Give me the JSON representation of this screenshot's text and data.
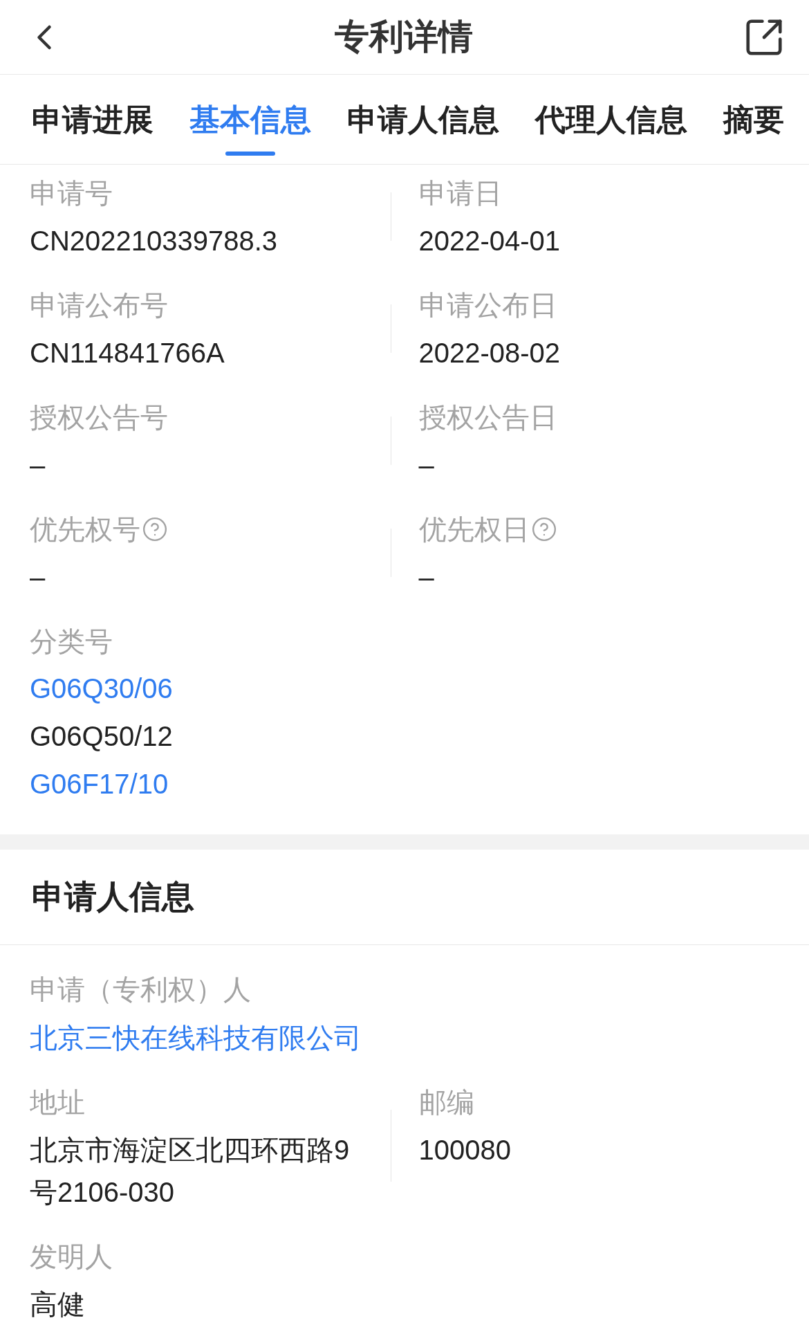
{
  "header": {
    "title": "专利详情"
  },
  "tabs": [
    {
      "label": "申请进展",
      "selected": false
    },
    {
      "label": "基本信息",
      "selected": true
    },
    {
      "label": "申请人信息",
      "selected": false
    },
    {
      "label": "代理人信息",
      "selected": false
    },
    {
      "label": "摘要",
      "selected": false
    }
  ],
  "basic_info": {
    "rows": [
      {
        "left": {
          "label": "申请号",
          "value": "CN202210339788.3",
          "help": false
        },
        "right": {
          "label": "申请日",
          "value": "2022-04-01",
          "help": false
        }
      },
      {
        "left": {
          "label": "申请公布号",
          "value": "CN114841766A",
          "help": false
        },
        "right": {
          "label": "申请公布日",
          "value": "2022-08-02",
          "help": false
        }
      },
      {
        "left": {
          "label": "授权公告号",
          "value": "–",
          "help": false
        },
        "right": {
          "label": "授权公告日",
          "value": "–",
          "help": false
        }
      },
      {
        "left": {
          "label": "优先权号",
          "value": "–",
          "help": true
        },
        "right": {
          "label": "优先权日",
          "value": "–",
          "help": true
        }
      }
    ],
    "classification": {
      "label": "分类号",
      "codes": [
        {
          "text": "G06Q30/06",
          "link": true
        },
        {
          "text": "G06Q50/12",
          "link": false
        },
        {
          "text": "G06F17/10",
          "link": true
        }
      ]
    }
  },
  "applicant_info": {
    "title": "申请人信息",
    "applicant": {
      "label": "申请（专利权）人",
      "value": "北京三快在线科技有限公司",
      "link": true
    },
    "address": {
      "label": "地址",
      "value": "北京市海淀区北四环西路9号2106-030"
    },
    "postal_code": {
      "label": "邮编",
      "value": "100080"
    },
    "inventor": {
      "label": "发明人",
      "value": "高健"
    }
  }
}
